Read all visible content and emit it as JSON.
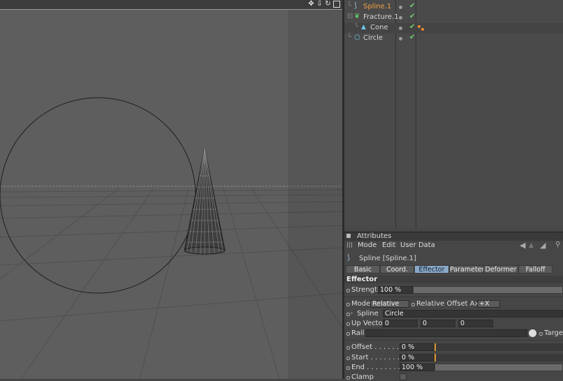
{
  "viewport": {
    "toolbar_icons": [
      "move-icon",
      "down-arrow-icon",
      "rotate-icon",
      "maximize-icon"
    ]
  },
  "object_manager": {
    "objects": [
      {
        "name": "Spline.1",
        "color": "#f0a040",
        "icon": "spline-icon"
      },
      {
        "name": "Fracture.1",
        "color": "#cfe0ef",
        "icon": "fracture-icon"
      },
      {
        "name": "Cone",
        "color": "#cfe0ef",
        "icon": "cone-icon"
      },
      {
        "name": "Circle",
        "color": "#cfe0ef",
        "icon": "circle-icon"
      }
    ]
  },
  "attributes": {
    "panel_title": "Attributes",
    "menu": {
      "mode": "Mode",
      "edit": "Edit",
      "user_data": "User Data"
    },
    "object_label": "Spline [Spline.1]",
    "tabs": [
      "Basic",
      "Coord.",
      "Effector",
      "Parameter",
      "Deformer",
      "Falloff"
    ],
    "active_tab": "Effector",
    "section": "Effector",
    "strength_label": "Strength",
    "strength_value": "100 %",
    "mode_label": "Mode",
    "mode_value": "Relative",
    "rel_offset_label": "Relative Offset Axis",
    "rel_offset_value": "+X",
    "spline_label": "Spline",
    "spline_value": "Circle",
    "up_vector_label": "Up Vector",
    "up_vector": [
      "0",
      "0",
      "0"
    ],
    "rail_label": "Rail",
    "target_label": "Target",
    "offset_label": "Offset . . . . . . . . .",
    "offset_value": "0 %",
    "start_label": "Start . . . . . . . . . .",
    "start_value": "0 %",
    "end_label": "End . . . . . . . . . . .",
    "end_value": "100 %",
    "clamp_label": "Clamp"
  }
}
